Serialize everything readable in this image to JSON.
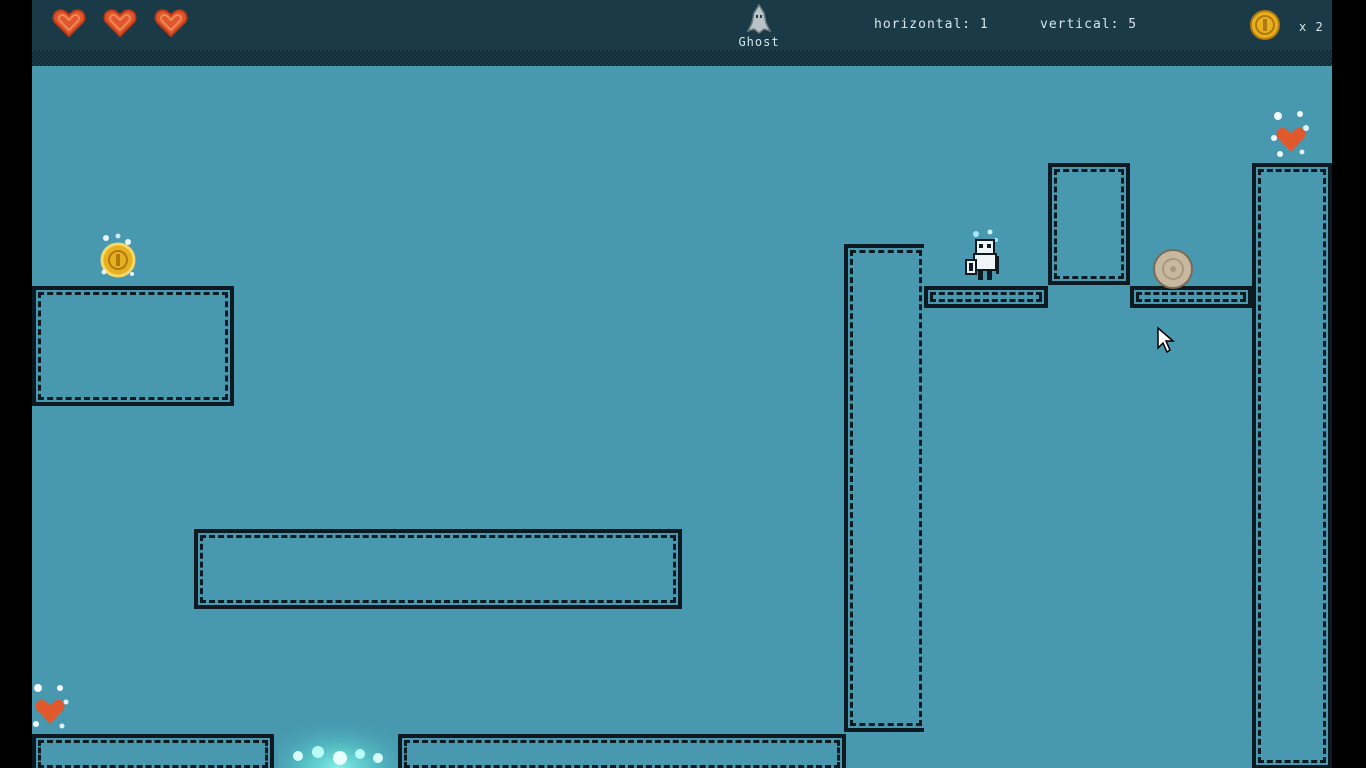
{
  "hud": {
    "lives": 3,
    "character_name": "Ghost",
    "horizontal_label": "horizontal: 1",
    "vertical_label": "vertical: 5",
    "coin_count": "x 2"
  },
  "colors": {
    "hud_background": "#1a3a48",
    "sky": "#4899b0",
    "brick_outline": "#0e1a22",
    "heart": "#e0582c",
    "coin": "#e8b020",
    "hud_text": "#d8e6ea"
  },
  "icons": {
    "life": "heart-icon",
    "character": "ghost-icon",
    "coin": "coin-icon",
    "cursor": "mouse-cursor-icon"
  },
  "world": {
    "pickups": [
      {
        "kind": "coin",
        "name": "coin-pickup"
      },
      {
        "kind": "heart",
        "name": "heart-pickup-top-right"
      },
      {
        "kind": "heart",
        "name": "heart-pickup-bottom-left"
      }
    ],
    "enemies": [
      {
        "kind": "rolling-boulder",
        "name": "boulder-enemy"
      }
    ],
    "hazards": [
      {
        "kind": "glowing-spawn",
        "name": "glow-pit"
      }
    ]
  }
}
